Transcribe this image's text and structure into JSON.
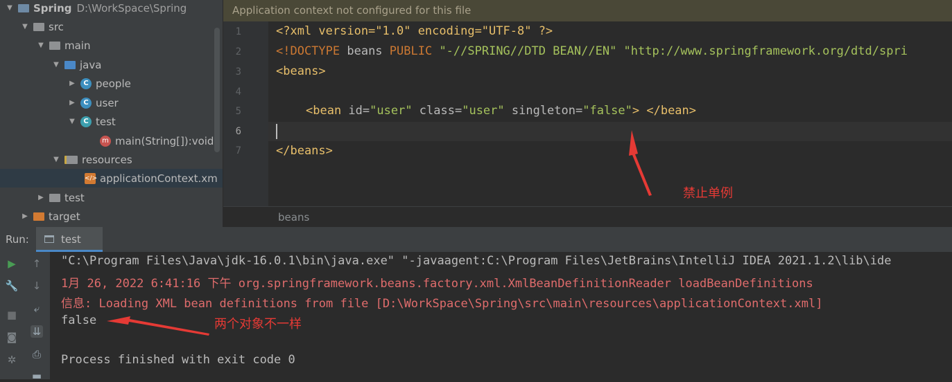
{
  "tree": {
    "project_name": "Spring",
    "project_path": "D:\\WorkSpace\\Spring",
    "items": [
      {
        "label": "src"
      },
      {
        "label": "main"
      },
      {
        "label": "java"
      },
      {
        "label": "people"
      },
      {
        "label": "user"
      },
      {
        "label": "test"
      },
      {
        "label": "main(String[]):void"
      },
      {
        "label": "resources"
      },
      {
        "label": "applicationContext.xm"
      },
      {
        "label": "test"
      },
      {
        "label": "target"
      }
    ]
  },
  "editor": {
    "banner": "Application context not configured for this file",
    "line_numbers": [
      "1",
      "2",
      "3",
      "4",
      "5",
      "6",
      "7"
    ],
    "breadcrumb": "beans"
  },
  "run": {
    "label": "Run:",
    "tab": "test",
    "console": [
      "\"C:\\Program Files\\Java\\jdk-16.0.1\\bin\\java.exe\" \"-javaagent:C:\\Program Files\\JetBrains\\IntelliJ IDEA 2021.1.2\\lib\\ide",
      "1月 26, 2022 6:41:16 下午 org.springframework.beans.factory.xml.XmlBeanDefinitionReader loadBeanDefinitions",
      "信息: Loading XML bean definitions from file [D:\\WorkSpace\\Spring\\src\\main\\resources\\applicationContext.xml]",
      "false",
      "Process finished with exit code 0"
    ]
  },
  "annotations": {
    "note1": "禁止单例",
    "note2": "两个对象不一样"
  },
  "code": {
    "l1": "<?xml version=\"1.0\" encoding=\"UTF-8\" ?>",
    "l2_doctype": "<!DOCTYPE",
    "l2_rest1": " beans ",
    "l2_public": "PUBLIC",
    "l2_rest2": " \"-//SPRING//DTD BEAN//EN\" \"http://www.springframework.org/dtd/spri",
    "l3": "<beans>",
    "l5_open": "<bean",
    "l5_id_attr": " id=",
    "l5_id_val": "\"user\"",
    "l5_class_attr": " class=",
    "l5_class_val": "\"user\"",
    "l5_single_attr": " singleton=",
    "l5_single_val": "\"false\"",
    "l5_close": "> </bean>",
    "l7": "</beans>"
  },
  "colors": {
    "annotation": "#e53a35",
    "error": "#e06c6c"
  }
}
